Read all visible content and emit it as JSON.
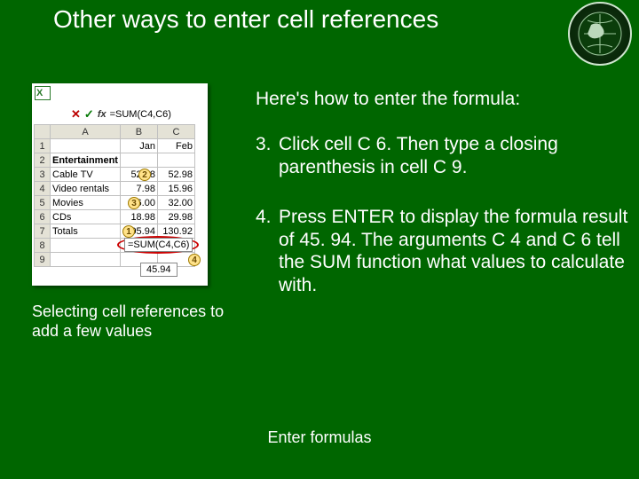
{
  "title": "Other ways to enter cell references",
  "intro": "Here's how to enter the formula:",
  "steps": {
    "s3": {
      "num": "3.",
      "text": "Click cell C 6. Then type a closing parenthesis in cell C 9."
    },
    "s4": {
      "num": "4.",
      "text": "Press ENTER to display the formula result of 45. 94. The arguments C 4 and C 6 tell the SUM function what values to calculate with."
    }
  },
  "caption": "Selecting cell references to add a few values",
  "footer": "Enter formulas",
  "sheet": {
    "formula_bar": "=SUM(C4,C6)",
    "fx": "fx",
    "x": "✕",
    "check": "✓",
    "col_headers": [
      "",
      "A",
      "B",
      "C"
    ],
    "rows": [
      {
        "r": "1",
        "a": "",
        "b": "Jan",
        "c": "Feb"
      },
      {
        "r": "2",
        "a": "Entertainment",
        "b": "",
        "c": ""
      },
      {
        "r": "3",
        "a": "Cable TV",
        "b": "52.98",
        "c": "52.98"
      },
      {
        "r": "4",
        "a": "Video rentals",
        "b": "7.98",
        "c": "15.96"
      },
      {
        "r": "5",
        "a": "Movies",
        "b": "16.00",
        "c": "32.00"
      },
      {
        "r": "6",
        "a": "CDs",
        "b": "18.98",
        "c": "29.98"
      },
      {
        "r": "7",
        "a": "Totals",
        "b": "95.94",
        "c": "130.92"
      },
      {
        "r": "8",
        "a": "",
        "b": "",
        "c": ""
      },
      {
        "r": "9",
        "a": "",
        "b": "",
        "c": ""
      }
    ],
    "inline_formula": "=SUM(C4,C6)",
    "result_value": "45.94",
    "callout_labels": {
      "c1": "1",
      "c2": "2",
      "c3": "3",
      "c4": "4"
    }
  }
}
